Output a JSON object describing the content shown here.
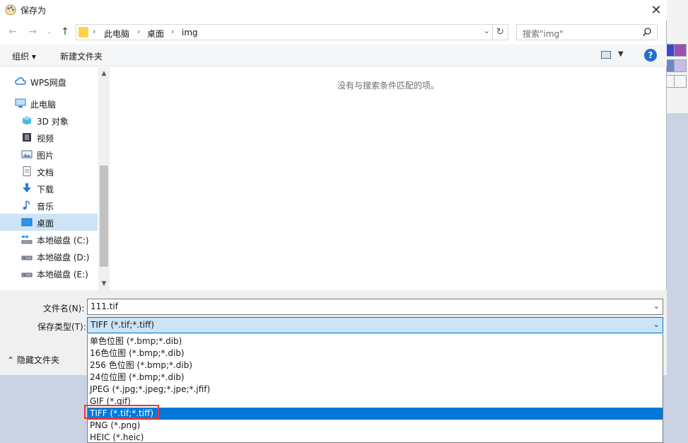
{
  "dialog": {
    "title": "保存为",
    "close_glyph": "✕"
  },
  "nav": {
    "back_glyph": "←",
    "forward_glyph": "→",
    "recent_glyph": "⌄",
    "up_glyph": "↑",
    "breadcrumb": [
      "此电脑",
      "桌面",
      "img"
    ],
    "crumb_sep": "›",
    "dropdown_glyph": "⌄",
    "refresh_glyph": "↻",
    "search_placeholder": "搜索\"img\""
  },
  "toolbar": {
    "organize": "组织 ▾",
    "new_folder": "新建文件夹",
    "view_dd": "▼",
    "help": "?"
  },
  "sidebar": {
    "items": [
      {
        "label": "WPS网盘",
        "icon": "cloud-icon"
      },
      {
        "label": "此电脑",
        "icon": "computer-icon"
      },
      {
        "label": "3D 对象",
        "icon": "3d-objects-icon"
      },
      {
        "label": "视频",
        "icon": "video-icon"
      },
      {
        "label": "图片",
        "icon": "pictures-icon"
      },
      {
        "label": "文档",
        "icon": "documents-icon"
      },
      {
        "label": "下载",
        "icon": "download-icon"
      },
      {
        "label": "音乐",
        "icon": "music-icon"
      },
      {
        "label": "桌面",
        "icon": "desktop-icon",
        "selected": true
      },
      {
        "label": "本地磁盘 (C:)",
        "icon": "drive-c-icon"
      },
      {
        "label": "本地磁盘 (D:)",
        "icon": "drive-icon"
      },
      {
        "label": "本地磁盘 (E:)",
        "icon": "drive-icon"
      }
    ],
    "scroll_up": "▲",
    "scroll_down": "▼"
  },
  "content": {
    "empty_message": "没有与搜索条件匹配的项。"
  },
  "form": {
    "filename_label": "文件名(N):",
    "filename_value": "111.tif",
    "filetype_label": "保存类型(T):",
    "filetype_value": "TIFF (*.tif;*.tiff)",
    "combo_glyph": "⌄",
    "hide_folders": "⌃  隐藏文件夹"
  },
  "filetype_options": [
    {
      "label": "单色位图 (*.bmp;*.dib)"
    },
    {
      "label": "16色位图 (*.bmp;*.dib)"
    },
    {
      "label": "256 色位图 (*.bmp;*.dib)"
    },
    {
      "label": "24位位图 (*.bmp;*.dib)"
    },
    {
      "label": "JPEG (*.jpg;*.jpeg;*.jpe;*.jfif)"
    },
    {
      "label": "GIF (*.gif)"
    },
    {
      "label": "TIFF (*.tif;*.tiff)",
      "selected": true
    },
    {
      "label": "PNG (*.png)"
    },
    {
      "label": "HEIC (*.heic)"
    }
  ],
  "colors": {
    "accent": "#0078d7",
    "selection_bg": "#cce4f7",
    "highlight_box": "#e53935"
  }
}
